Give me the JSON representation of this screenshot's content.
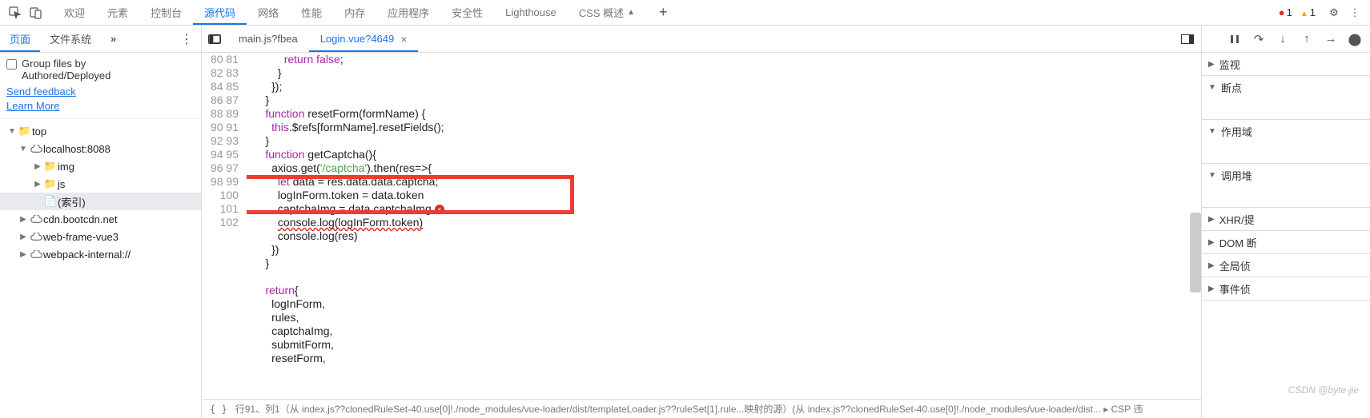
{
  "topbar": {
    "tabs": [
      "欢迎",
      "元素",
      "控制台",
      "源代码",
      "网络",
      "性能",
      "内存",
      "应用程序",
      "安全性",
      "Lighthouse",
      "CSS 概述"
    ],
    "active": "源代码",
    "status": {
      "errors": "1",
      "warnings": "1"
    }
  },
  "left": {
    "subtabs": {
      "items": [
        "页面",
        "文件系统"
      ],
      "active": "页面",
      "more": "»",
      "dots": "⋮"
    },
    "opts": {
      "checkbox_label1": "Group files by",
      "checkbox_label2": "Authored/Deployed",
      "link1": "Send feedback",
      "link2": "Learn More"
    },
    "tree": [
      {
        "pad": 8,
        "arrow": "down",
        "icon": "📁",
        "label": "top",
        "cls": ""
      },
      {
        "pad": 22,
        "arrow": "down",
        "icon": "cloud",
        "label": "localhost:8088",
        "cls": ""
      },
      {
        "pad": 40,
        "arrow": "right",
        "icon": "📁",
        "label": "img",
        "cls": "folder"
      },
      {
        "pad": 40,
        "arrow": "right",
        "icon": "📁",
        "label": "js",
        "cls": "folder"
      },
      {
        "pad": 40,
        "arrow": "",
        "icon": "📄",
        "label": "(索引)",
        "cls": "sel"
      },
      {
        "pad": 22,
        "arrow": "right",
        "icon": "cloud",
        "label": "cdn.bootcdn.net",
        "cls": ""
      },
      {
        "pad": 22,
        "arrow": "right",
        "icon": "cloud",
        "label": "web-frame-vue3",
        "cls": ""
      },
      {
        "pad": 22,
        "arrow": "right",
        "icon": "cloud",
        "label": "webpack-internal://",
        "cls": ""
      }
    ]
  },
  "center": {
    "tabs": [
      {
        "label": "main.js?fbea",
        "active": false,
        "close": false
      },
      {
        "label": "Login.vue?4649",
        "active": true,
        "close": true
      }
    ],
    "first_line": 80,
    "code_lines": [
      "            return false;",
      "          }",
      "        });",
      "      }",
      "      function resetForm(formName) {",
      "        this.$refs[formName].resetFields();",
      "      }",
      "      function getCaptcha(){",
      "        axios.get('/captcha').then(res=>{",
      "          let data = res.data.data.captcha;",
      "          logInForm.token = data.token",
      "          captchaImg = data.captchaImg",
      "          console.log(logInForm.token)",
      "          console.log(res)",
      "        })",
      "      }",
      "",
      "      return{",
      "        logInForm,",
      "        rules,",
      "        captchaImg,",
      "        submitForm,",
      "        resetForm,"
    ],
    "status": {
      "brace": "{ }",
      "pos": "行91、列1（从 index.js??clonedRuleSet-40.use[0]!./node_modules/vue-loader/dist/templateLoader.js??ruleSet[1].rule...映射的源）(从 index.js??clonedRuleSet-40.use[0]!./node_modules/vue-loader/dist... ▸ CSP 违"
    }
  },
  "right": {
    "sections": [
      {
        "label": "监视",
        "open": false,
        "body": false
      },
      {
        "label": "断点",
        "open": true,
        "body": true
      },
      {
        "label": "作用域",
        "open": true,
        "body": true
      },
      {
        "label": "调用堆",
        "open": true,
        "body": true
      },
      {
        "label": "XHR/提",
        "open": false,
        "body": false
      },
      {
        "label": "DOM 断",
        "open": false,
        "body": false
      },
      {
        "label": "全局侦",
        "open": false,
        "body": false
      },
      {
        "label": "事件侦",
        "open": false,
        "body": false
      }
    ]
  },
  "watermark": "CSDN @byte-jie"
}
